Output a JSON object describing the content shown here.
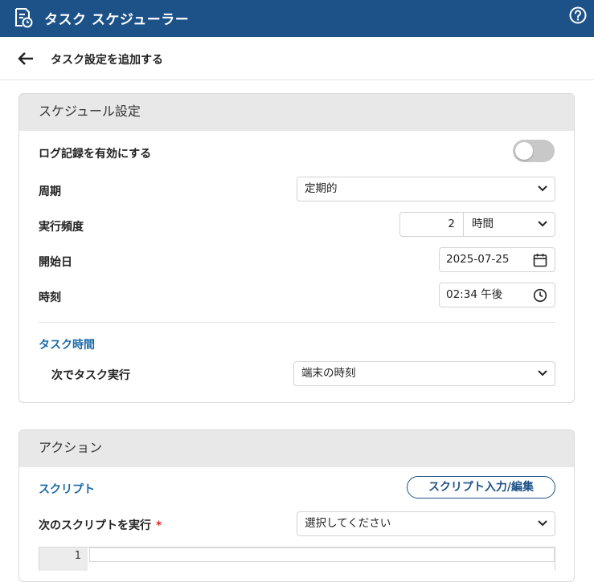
{
  "app": {
    "title": "タスク スケジューラー"
  },
  "page": {
    "title": "タスク設定を追加する"
  },
  "schedule": {
    "header": "スケジュール設定",
    "logging_label": "ログ記録を有効にする",
    "logging_enabled": false,
    "period_label": "周期",
    "period_value": "定期的",
    "frequency_label": "実行頻度",
    "frequency_value": "2",
    "frequency_unit": "時間",
    "start_date_label": "開始日",
    "start_date_value": "2025-07-25",
    "time_label": "時刻",
    "time_value": "02:34 午後",
    "task_time_section": "タスク時間",
    "run_task_label": "次でタスク実行",
    "run_task_value": "端末の時刻"
  },
  "action": {
    "header": "アクション",
    "script_section": "スクリプト",
    "script_edit_button": "スクリプト入力/編集",
    "run_script_label": "次のスクリプトを実行",
    "required_mark": "*",
    "run_script_placeholder": "選択してください",
    "editor_line_number": "1"
  },
  "icons": {
    "app_logo": "document-clock-icon",
    "help": "help-circle-icon",
    "back": "back-arrow-icon",
    "chevron": "chevron-down-icon",
    "calendar": "calendar-icon",
    "clock": "clock-icon"
  },
  "colors": {
    "header_bg": "#1d5288",
    "accent": "#1a6aa8",
    "section_bg": "#e8e8e8",
    "required": "#d32f2f"
  }
}
